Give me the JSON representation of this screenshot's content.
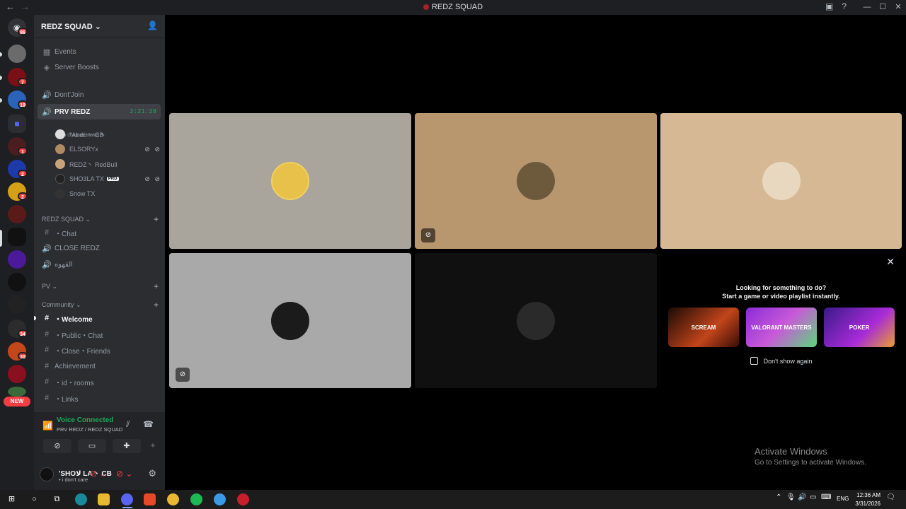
{
  "window": {
    "title": "REDZ SQUAD"
  },
  "guilds": {
    "home_badge": "86",
    "badges": [
      "7",
      "19",
      "1",
      "2",
      "2",
      "34",
      "30"
    ],
    "new_label": "NEW"
  },
  "server": {
    "name": "REDZ SQUAD"
  },
  "top_items": [
    {
      "label": "Events",
      "icon": "calendar-icon"
    },
    {
      "label": "Server Boosts",
      "icon": "boost-icon"
    }
  ],
  "voice_channels": {
    "dont_join": "Dont'Join",
    "prv_redz": "PRV REDZ",
    "prv_timer": "2:21:28",
    "channel_status": "Set a channel status"
  },
  "voice_users": [
    {
      "name": "\"Abdo丶 CB",
      "badge": "",
      "icons": ""
    },
    {
      "name": "ELSORYx",
      "badge": "",
      "icons": "⊘ ⊘"
    },
    {
      "name": "REDZ丶 RedBull",
      "badge": "",
      "icons": ""
    },
    {
      "name": "SHO3LA TX",
      "badge": "PRD",
      "icons": "⊘ ⊘"
    },
    {
      "name": "Snow TX",
      "badge": "",
      "icons": ""
    }
  ],
  "categories": {
    "redz_squad": "REDZ SQUAD",
    "pv": "PV",
    "community": "Community"
  },
  "redz_channels": [
    {
      "label": "・Chat",
      "type": "text"
    },
    {
      "label": "CLOSE REDZ",
      "type": "voice"
    },
    {
      "label": "القهوه",
      "type": "voice"
    }
  ],
  "community_channels": [
    {
      "label": "・Welcome",
      "bold": true
    },
    {
      "label": "・Public・Chat",
      "bold": false
    },
    {
      "label": "・Close・Friends",
      "bold": false
    },
    {
      "label": "Achievement",
      "bold": false
    },
    {
      "label": "・id・rooms",
      "bold": false
    },
    {
      "label": "・Links",
      "bold": false
    }
  ],
  "voice_panel": {
    "status": "Voice Connected",
    "location": "PRV REDZ / REDZ SQUAD"
  },
  "user": {
    "name": "'SHOلا LA丶 CB",
    "status": "• i don't care"
  },
  "activity": {
    "heading1": "Looking for something to do?",
    "heading2": "Start a game or video playlist instantly.",
    "cards": [
      "SCREAM",
      "VALORANT MASTERS",
      "POKER"
    ],
    "dont_show": "Don't show again"
  },
  "watermark": {
    "line1": "Activate Windows",
    "line2": "Go to Settings to activate Windows."
  },
  "taskbar": {
    "lang": "ENG",
    "time": "12:36 AM",
    "date": "3/31/2026"
  },
  "colors": {
    "accent_green": "#23a55a",
    "danger_red": "#f23f43",
    "tile1": "#aaa59c",
    "tile2": "#b8976f",
    "tile3": "#d6b994",
    "tile4": "#a9a9a9",
    "tile5": "#101010"
  }
}
